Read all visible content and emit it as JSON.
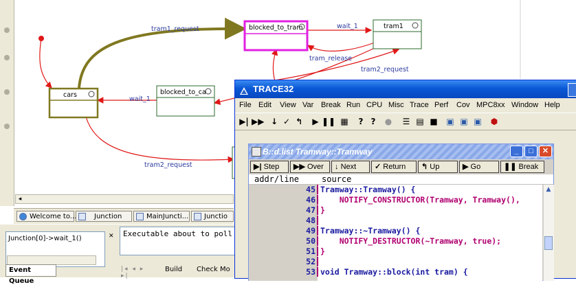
{
  "diagram": {
    "states": [
      {
        "name": "blocked_to_tram"
      },
      {
        "name": "tram1"
      },
      {
        "name": "cars"
      },
      {
        "name": "blocked_to_ca"
      }
    ],
    "transitions": [
      {
        "label": "tram1_request"
      },
      {
        "label": "wait_1"
      },
      {
        "label": "tram_release"
      },
      {
        "label": "tram2_request"
      },
      {
        "label": "wait_1"
      },
      {
        "label": "tram2_request"
      }
    ],
    "colors": {
      "highlight_state": "#e020e0",
      "active_path": "#807820",
      "transition": "#e01818",
      "label": "#2b3a9c"
    }
  },
  "tabs": [
    {
      "label": "Welcome to...",
      "icon": "globe-icon"
    },
    {
      "label": "Junction",
      "icon": "chart-icon"
    },
    {
      "label": "MainJuncti...",
      "icon": "diagram-icon"
    },
    {
      "label": "Junctio",
      "icon": "chart-icon"
    }
  ],
  "event_queue": {
    "item": "Junction[0]->wait_1()",
    "tab_label": "Event Queue"
  },
  "output": {
    "text": "Executable about to poll",
    "tabs": [
      "Build",
      "Check Mo"
    ]
  },
  "trace32": {
    "title": "TRACE32",
    "menus": [
      "File",
      "Edit",
      "View",
      "Var",
      "Break",
      "Run",
      "CPU",
      "Misc",
      "Trace",
      "Perf",
      "Cov",
      "MPC8xx",
      "Window",
      "Help"
    ],
    "list_window": {
      "title": "B::d.list Tramway::Tramway",
      "buttons": [
        "Step",
        "Over",
        "Next",
        "Return",
        "Up",
        "Go",
        "Break"
      ],
      "header": {
        "addr": "addr/line",
        "source": "source"
      },
      "lines": [
        {
          "num": "45",
          "code": "Tramway::Tramway() {"
        },
        {
          "num": "46",
          "code": "    NOTIFY_CONSTRUCTOR(Tramway, Tramway(),"
        },
        {
          "num": "47",
          "code": "}"
        },
        {
          "num": "48",
          "code": ""
        },
        {
          "num": "49",
          "code": "Tramway::~Tramway() {"
        },
        {
          "num": "50",
          "code": "    NOTIFY_DESTRUCTOR(~Tramway, true);"
        },
        {
          "num": "51",
          "code": "}"
        },
        {
          "num": "52",
          "code": ""
        },
        {
          "num": "53",
          "code": "void Tramway::block(int tram) {"
        }
      ]
    }
  }
}
